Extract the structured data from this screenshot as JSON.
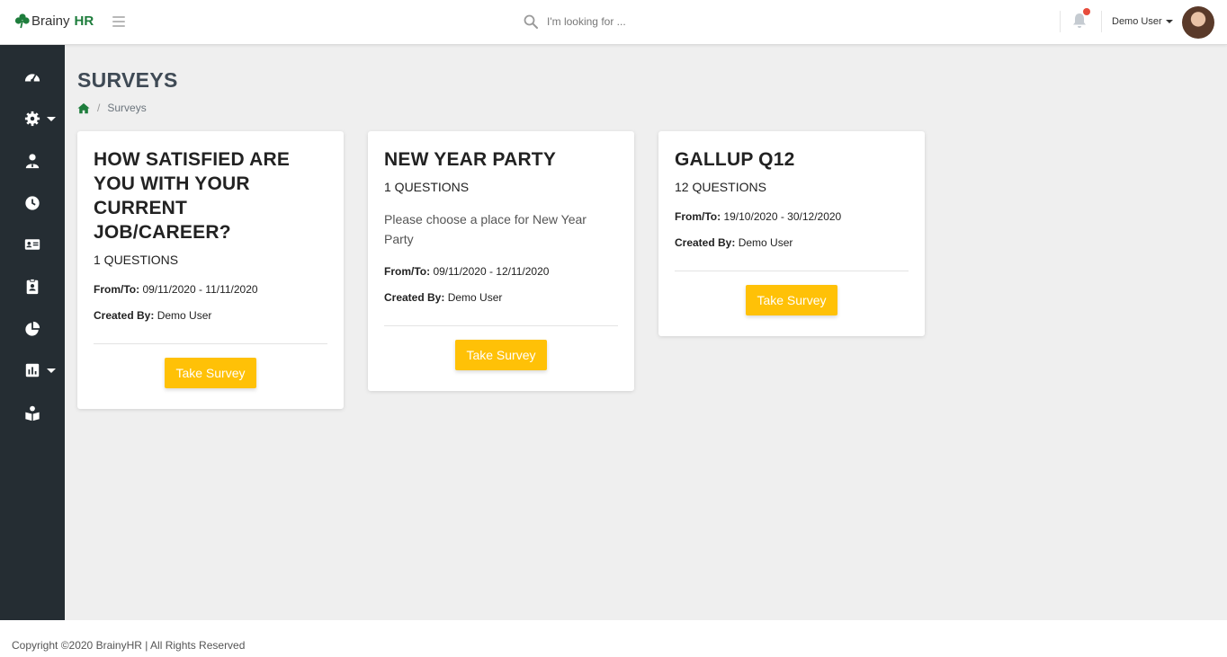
{
  "app": {
    "brand_name": "Brainy",
    "brand_suffix": "HR",
    "accent_color": "#ffc107",
    "brand_color": "#1e7d3c"
  },
  "header": {
    "search_placeholder": "I'm looking for ...",
    "user_name": "Demo User",
    "notification_indicator": "red-dot"
  },
  "sidebar": {
    "items": [
      {
        "icon": "dashboard-icon"
      },
      {
        "icon": "gear-icon",
        "has_dropdown": true
      },
      {
        "icon": "user-icon"
      },
      {
        "icon": "clock-icon"
      },
      {
        "icon": "id-card-icon"
      },
      {
        "icon": "id-badge-icon"
      },
      {
        "icon": "pie-chart-icon"
      },
      {
        "icon": "bar-chart-icon",
        "has_dropdown": true
      },
      {
        "icon": "book-reader-icon"
      }
    ]
  },
  "page": {
    "title": "SURVEYS",
    "breadcrumb": {
      "current": "Surveys",
      "separator": "/"
    }
  },
  "surveys": [
    {
      "title": "HOW SATISFIED ARE YOU WITH YOUR CURRENT JOB/CAREER?",
      "questions": "1 QUESTIONS",
      "description": "",
      "from_to_label": "From/To:",
      "from_to": "09/11/2020 - 11/11/2020",
      "created_by_label": "Created By:",
      "created_by": "Demo User",
      "button": "Take Survey"
    },
    {
      "title": "NEW YEAR PARTY",
      "questions": "1 QUESTIONS",
      "description": "Please choose a place for New Year Party",
      "from_to_label": "From/To:",
      "from_to": "09/11/2020 - 12/11/2020",
      "created_by_label": "Created By:",
      "created_by": "Demo User",
      "button": "Take Survey"
    },
    {
      "title": "GALLUP Q12",
      "questions": "12 QUESTIONS",
      "description": "",
      "from_to_label": "From/To:",
      "from_to": "19/10/2020 - 30/12/2020",
      "created_by_label": "Created By:",
      "created_by": "Demo User",
      "button": "Take Survey"
    }
  ],
  "footer": {
    "copyright": "Copyright ©2020 BrainyHR | All Rights Reserved"
  }
}
